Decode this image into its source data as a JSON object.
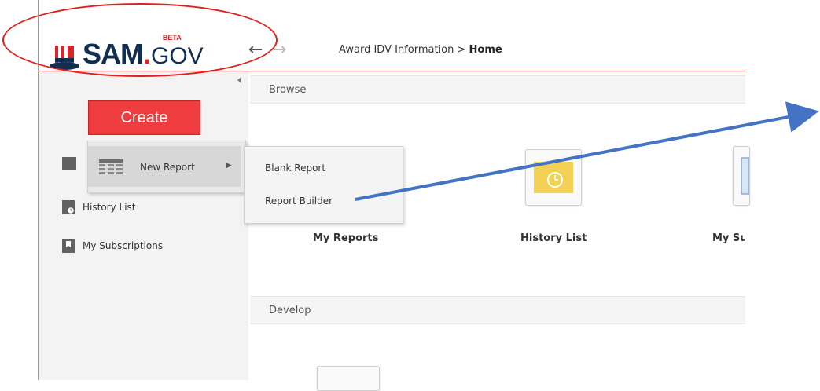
{
  "header": {
    "logo_text_main": "SAM",
    "logo_text_dot": ".",
    "logo_text_gov": "GOV",
    "logo_beta": "BETA",
    "breadcrumb_parent": "Award IDV Information",
    "breadcrumb_sep": ">",
    "breadcrumb_current": "Home"
  },
  "sidebar": {
    "create_label": "Create",
    "items": [
      {
        "label": "History List",
        "icon": "history-icon"
      },
      {
        "label": "My Subscriptions",
        "icon": "subscriptions-icon"
      }
    ]
  },
  "create_menu": {
    "new_report_label": "New Report",
    "submenu": [
      {
        "label": "Blank Report"
      },
      {
        "label": "Report Builder"
      }
    ]
  },
  "main": {
    "sections": [
      {
        "label": "Browse"
      },
      {
        "label": "Develop"
      }
    ],
    "tiles": [
      {
        "label": "My Reports"
      },
      {
        "label": "History List"
      },
      {
        "label": "My Su"
      }
    ]
  },
  "colors": {
    "brand_blue": "#112e51",
    "brand_red": "#d9262b",
    "create_red": "#ef3d3f",
    "annotation_red": "#e0201c",
    "annotation_blue": "#4472c4",
    "history_tile_yellow": "#f2d154"
  }
}
